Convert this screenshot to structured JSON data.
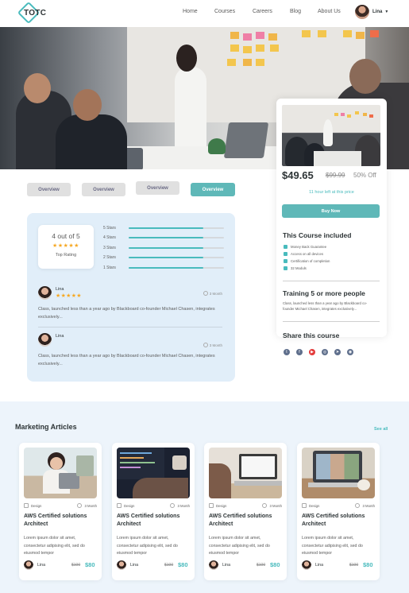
{
  "brand": {
    "logo_text": "TOTC"
  },
  "nav": {
    "links": [
      "Home",
      "Courses",
      "Careers",
      "Blog",
      "About Us"
    ],
    "user_name": "Lina"
  },
  "tabs": [
    "Overview",
    "Overview",
    "Overview",
    "Overview"
  ],
  "tabs_active_index": 3,
  "rating": {
    "summary": "4 out of 5",
    "stars_label": "★★★★★",
    "label": "Top Rating",
    "bars": [
      {
        "label": "5 Stars",
        "fraction": 0.78
      },
      {
        "label": "4 Stars",
        "fraction": 0.78
      },
      {
        "label": "3 Stars",
        "fraction": 0.78
      },
      {
        "label": "2 Stars",
        "fraction": 0.78
      },
      {
        "label": "1 Stars",
        "fraction": 0.78
      }
    ]
  },
  "reviews": [
    {
      "name": "Lina",
      "stars": "★★★★★",
      "time": "3 Month",
      "text": "Class, launched less than a year ago by Blackboard co-founder Michael Chasen, integrates exclusively..."
    },
    {
      "name": "Lina",
      "stars": "",
      "time": "3 Month",
      "text": "Class, launched less than a year ago by Blackboard co-founder Michael Chasen, integrates exclusively..."
    }
  ],
  "purchase": {
    "price": "$49.65",
    "old_price": "$99.99",
    "discount": "50% Off",
    "time_left": "11 hour left at this price",
    "buy_label": "Buy Now"
  },
  "included": {
    "title": "This Course included",
    "items": [
      "Money Back Guarantee",
      "Access on all devices",
      "Certification of completion",
      "32 Moduls"
    ]
  },
  "training": {
    "title": "Training 5 or more people",
    "text": "Class, launched less than a year ago by Blackboard co-founder Michael Chasen, integrates exclusively..."
  },
  "share": {
    "title": "Share this course",
    "icons": [
      "twitter-icon",
      "facebook-icon",
      "youtube-icon",
      "instagram-icon",
      "telegram-icon",
      "messenger-icon"
    ]
  },
  "articles": {
    "title": "Marketing Articles",
    "see_all": "See all",
    "cards": [
      {
        "category": "Design",
        "duration": "3 Month",
        "title": "AWS Certified solutions Architect",
        "text": "Lorem ipsum dolor sit amet, consectetur adipising elit, sed do eiusmod tempor",
        "author": "Lina",
        "old_price": "$100",
        "price": "$80"
      },
      {
        "category": "Design",
        "duration": "3 Month",
        "title": "AWS Certified solutions Architect",
        "text": "Lorem ipsum dolor sit amet, consectetur adipising elit, sed do eiusmod tempor",
        "author": "Lina",
        "old_price": "$100",
        "price": "$80"
      },
      {
        "category": "Design",
        "duration": "3 Month",
        "title": "AWS Certified solutions Architect",
        "text": "Lorem ipsum dolor sit amet, consectetur adipising elit, sed do eiusmod tempor",
        "author": "Lina",
        "old_price": "$100",
        "price": "$80"
      },
      {
        "category": "Design",
        "duration": "3 Month",
        "title": "AWS Certified solutions Architect",
        "text": "Lorem ipsum dolor sit amet, consectetur adipising elit, sed do eiusmod tempor",
        "author": "Lina",
        "old_price": "$100",
        "price": "$80"
      }
    ]
  },
  "colors": {
    "accent": "#49bbbd",
    "button": "#5fb8b8",
    "star": "#f6a823",
    "panel": "#e1eef9",
    "section_bg": "#edf4fb"
  }
}
